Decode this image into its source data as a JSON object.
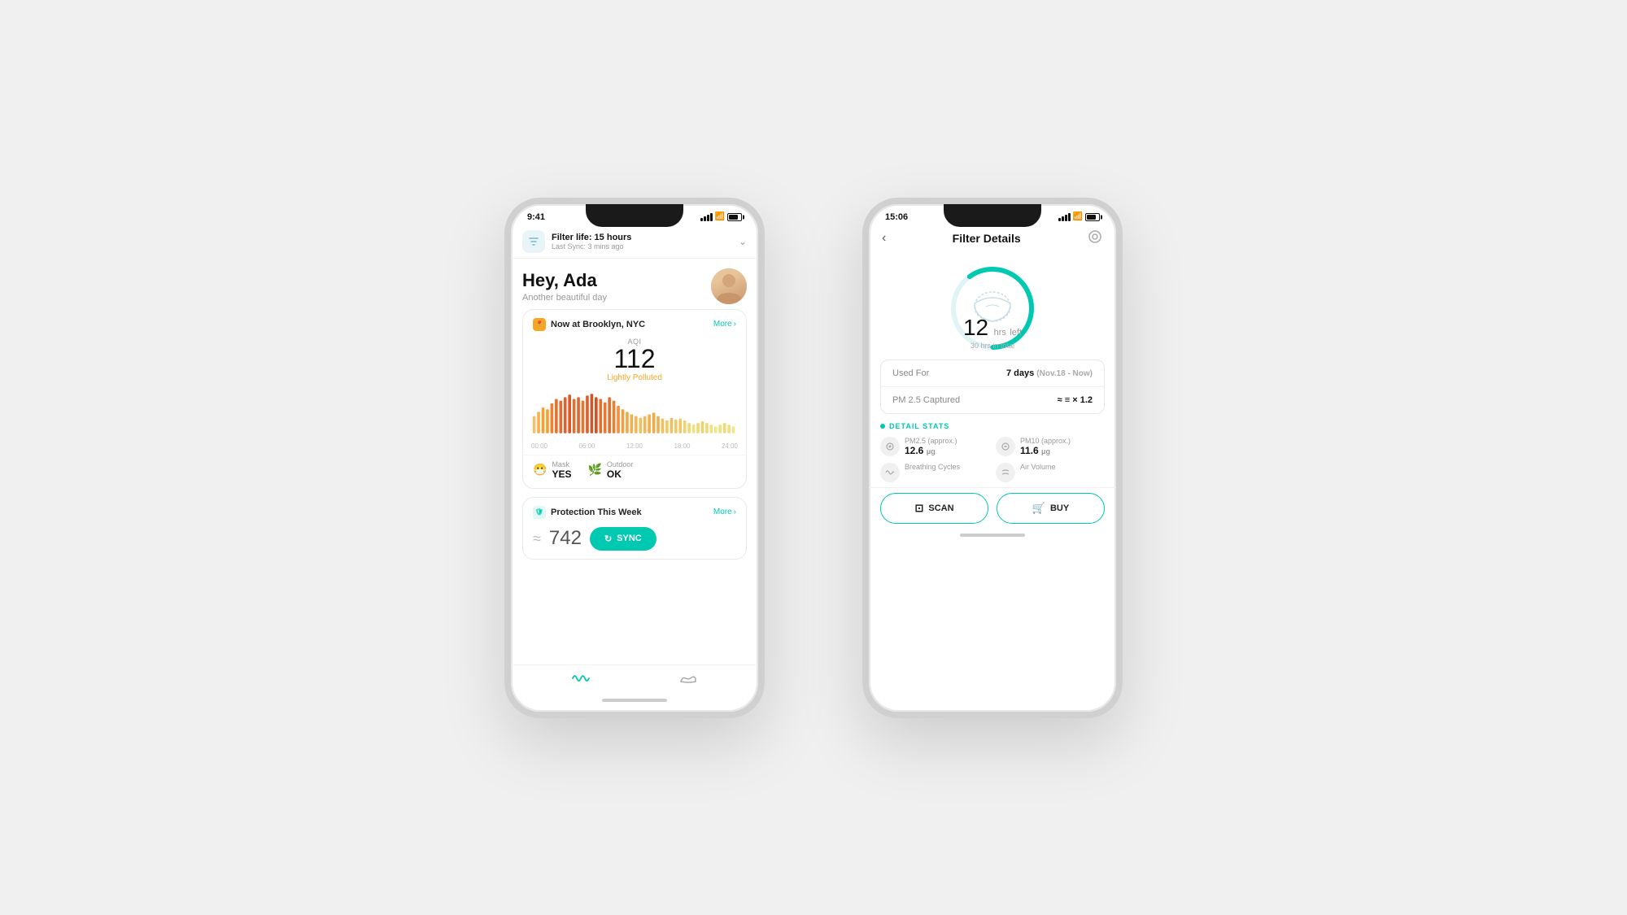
{
  "phone1": {
    "status_bar": {
      "time": "9:41",
      "signal": "signal",
      "wifi": "wifi",
      "battery": "battery"
    },
    "filter_bar": {
      "icon": "🔲",
      "title": "Filter life: 15 hours",
      "subtitle": "Last Sync: 3 mins ago",
      "chevron": "chevron"
    },
    "greeting": {
      "hey": "Hey, Ada",
      "sub": "Another beautiful day"
    },
    "location_card": {
      "location": "Now at Brooklyn, NYC",
      "more": "More",
      "aqi_label": "AQI",
      "aqi_value": "112",
      "aqi_status": "Lightly Polluted",
      "time_labels": [
        "00:00",
        "06:00",
        "12:00",
        "18:00",
        "24:00"
      ],
      "mask_label": "Mask",
      "mask_value": "YES",
      "outdoor_label": "Outdoor",
      "outdoor_value": "OK"
    },
    "protection_card": {
      "title": "Protection This Week",
      "more": "More",
      "count": "742",
      "sync_label": "SYNC"
    },
    "bottom_nav": {
      "item1": "waves",
      "item2": "shoe"
    }
  },
  "phone2": {
    "status_bar": {
      "time": "15:06"
    },
    "nav": {
      "back": "‹",
      "title": "Filter Details",
      "icon": "settings"
    },
    "filter_ring": {
      "hours_num": "12",
      "hours_unit": "hrs",
      "hours_suffix": "left",
      "total": "30 hrs in total",
      "progress_pct": 40
    },
    "stats": {
      "used_for_label": "Used For",
      "used_for_value": "7 days",
      "used_for_range": "(Nov.18 - Now)",
      "pm_label": "PM 2.5 Captured",
      "pm_value": "≈ ≡ × 1.2"
    },
    "detail_stats": {
      "title": "DETAIL STATS",
      "items": [
        {
          "label": "PM2.5 (approx.)",
          "value": "12.6",
          "unit": "μg"
        },
        {
          "label": "PM10 (approx.)",
          "value": "11.6",
          "unit": "μg"
        },
        {
          "label": "Breathing Cycles",
          "value": "",
          "unit": ""
        },
        {
          "label": "Air Volume",
          "value": "",
          "unit": ""
        }
      ]
    },
    "actions": {
      "scan_label": "SCAN",
      "buy_label": "BUY"
    }
  }
}
